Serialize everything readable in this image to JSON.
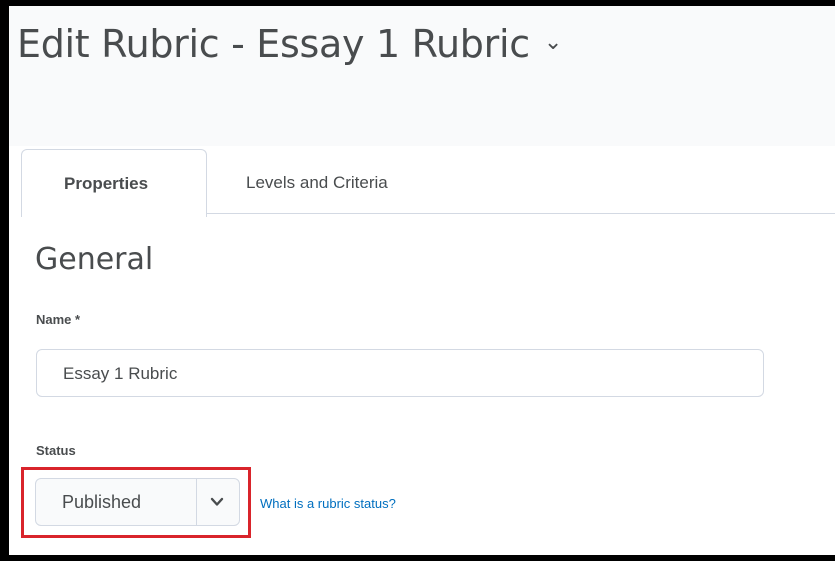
{
  "page": {
    "title": "Edit Rubric - Essay 1 Rubric",
    "title_chevron": "⌄"
  },
  "tabs": [
    {
      "label": "Properties",
      "active": true
    },
    {
      "label": "Levels and Criteria",
      "active": false
    }
  ],
  "section": {
    "heading": "General"
  },
  "name_field": {
    "label": "Name *",
    "value": "Essay 1 Rubric"
  },
  "status_field": {
    "label": "Status",
    "selected": "Published",
    "help_link": "What is a rubric status?"
  },
  "colors": {
    "highlight": "#d9242b",
    "link": "#006fbf",
    "text": "#494c4e"
  },
  "icons": {
    "title_dropdown": "chevron-down-icon",
    "select_arrow": "chevron-down-icon"
  }
}
